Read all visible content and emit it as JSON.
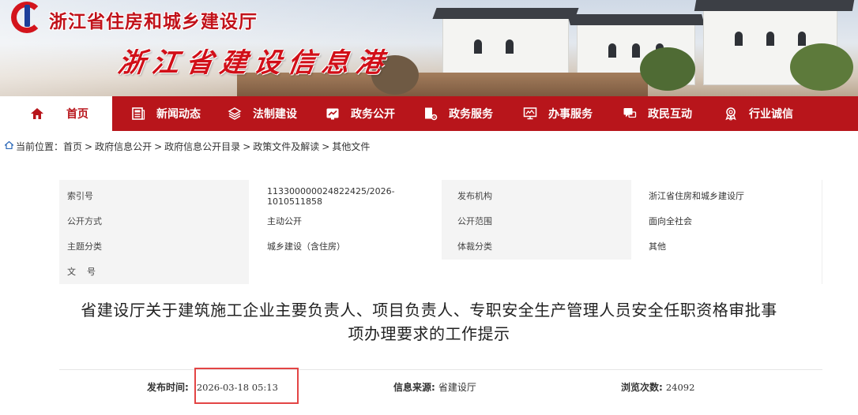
{
  "header": {
    "org_name": "浙江省住房和城乡建设厅",
    "site_name": "浙江省建设信息港"
  },
  "nav": {
    "items": [
      {
        "label": "首页",
        "icon": "home-icon"
      },
      {
        "label": "新闻动态",
        "icon": "newspaper-icon"
      },
      {
        "label": "法制建设",
        "icon": "layers-icon"
      },
      {
        "label": "政务公开",
        "icon": "chart-board-icon"
      },
      {
        "label": "政务服务",
        "icon": "document-gear-icon"
      },
      {
        "label": "办事服务",
        "icon": "monitor-icon"
      },
      {
        "label": "政民互动",
        "icon": "chat-icon"
      },
      {
        "label": "行业诚信",
        "icon": "badge-icon"
      }
    ]
  },
  "breadcrumb": {
    "prefix": "当前位置：",
    "items": [
      "首页",
      "政府信息公开",
      "政府信息公开目录",
      "政策文件及解读",
      "其他文件"
    ]
  },
  "meta": {
    "index_label": "索引号",
    "index_value": "113300000024822425/2026-1010511858",
    "publisher_label": "发布机构",
    "publisher_value": "浙江省住房和城乡建设厅",
    "mode_label": "公开方式",
    "mode_value": "主动公开",
    "scope_label": "公开范围",
    "scope_value": "面向全社会",
    "topic_label": "主题分类",
    "topic_value": "城乡建设（含住房）",
    "genre_label": "体裁分类",
    "genre_value": "其他",
    "docno_label": "文    号",
    "docno_value": ""
  },
  "article": {
    "title_line1": "省建设厅关于建筑施工企业主要负责人、项目负责人、专职安全生产管理人员安全任职资格审批事",
    "title_line2": "项办理要求的工作提示"
  },
  "info": {
    "publish_label": "发布时间:",
    "publish_value": "2026-03-18 05:13",
    "source_label": "信息来源:",
    "source_value": "省建设厅",
    "views_label": "浏览次数:",
    "views_value": "24092"
  },
  "colors": {
    "brand_red": "#b8151b",
    "highlight": "#e34545"
  }
}
